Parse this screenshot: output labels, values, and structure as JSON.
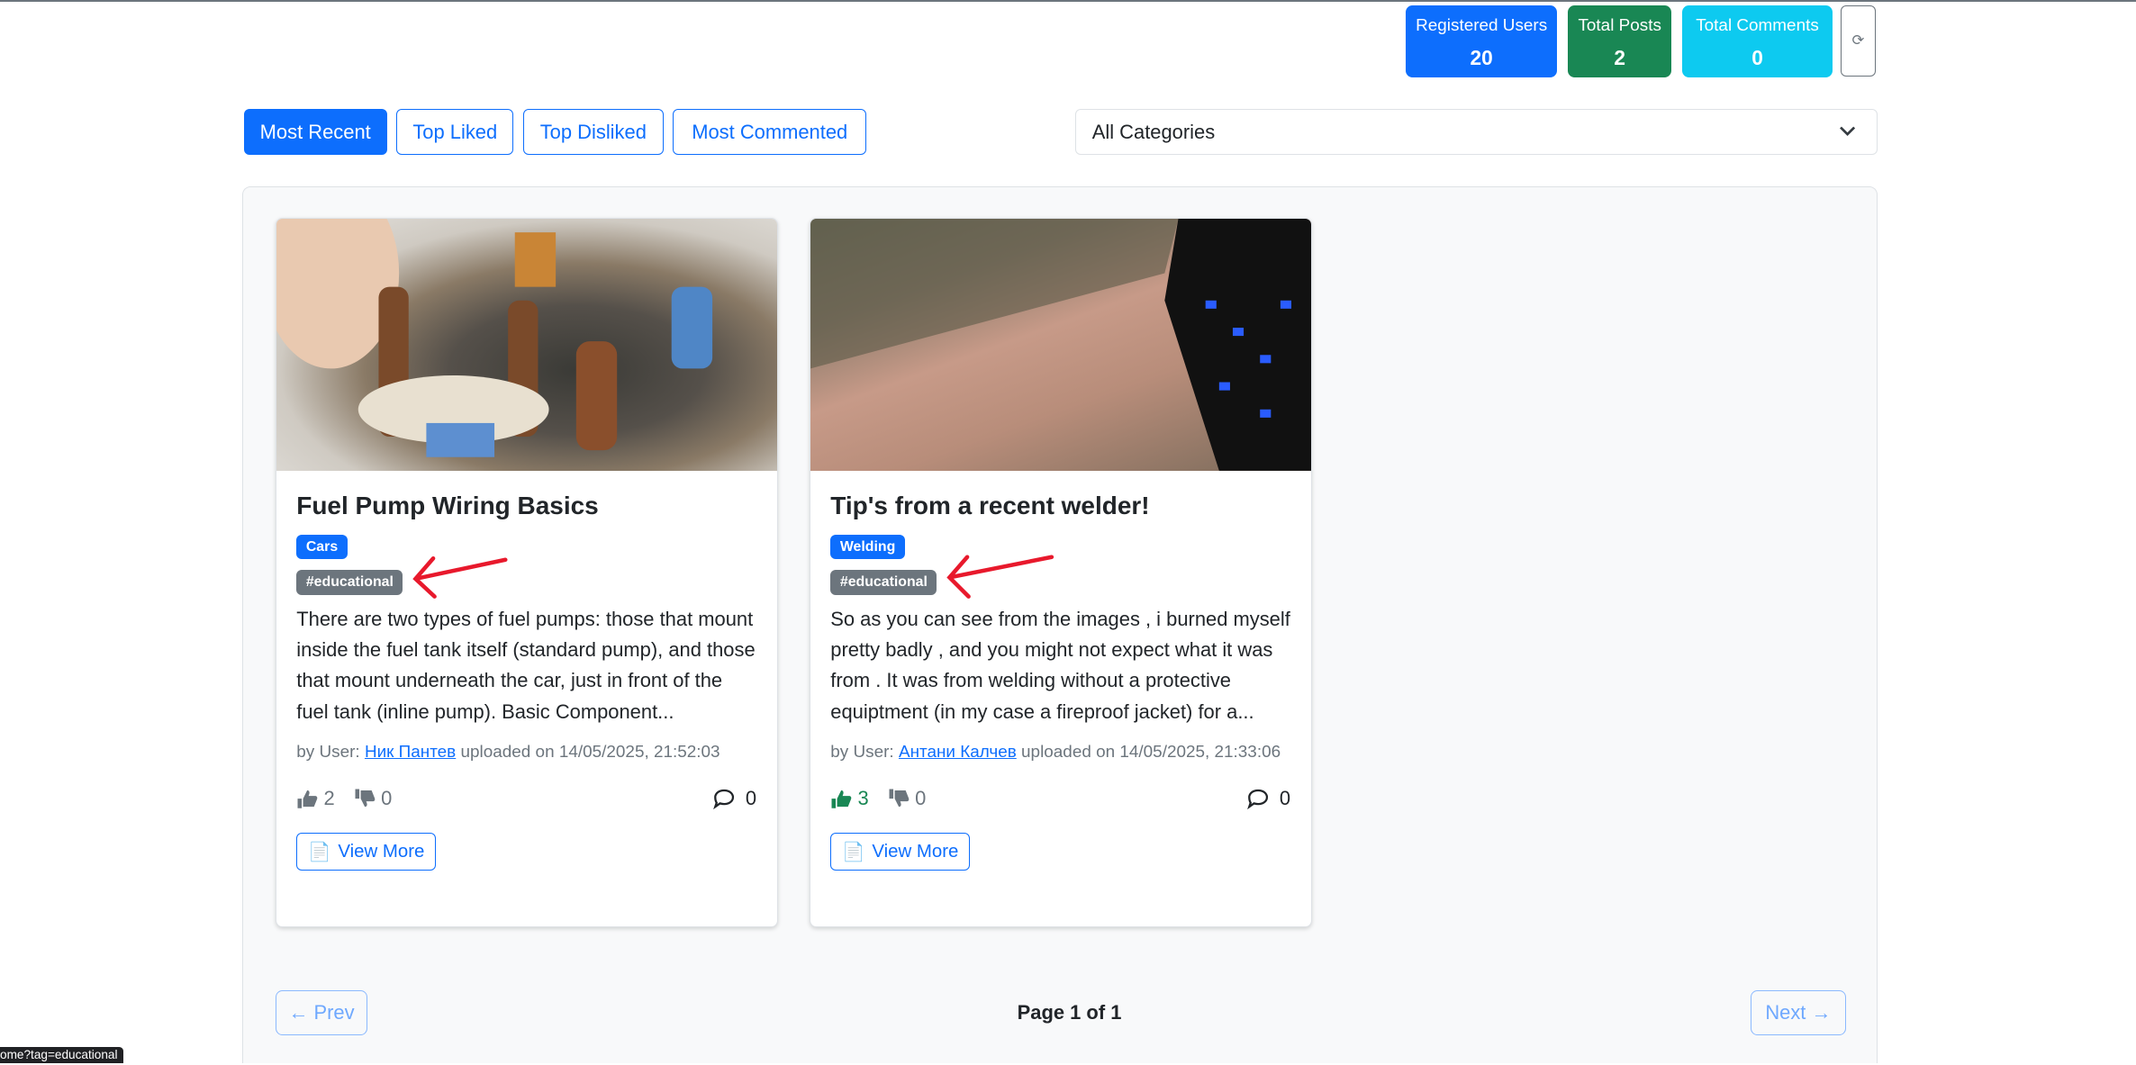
{
  "stats": {
    "registered_users": {
      "label": "Registered Users",
      "value": "20",
      "color": "#0d6efd"
    },
    "total_posts": {
      "label": "Total Posts",
      "value": "2",
      "color": "#198754"
    },
    "total_comments": {
      "label": "Total Comments",
      "value": "0",
      "color": "#0dcaf0"
    },
    "refresh_icon": "⟳"
  },
  "filters": {
    "buttons": [
      "Most Recent",
      "Top Liked",
      "Top Disliked",
      "Most Commented"
    ],
    "active": "Most Recent"
  },
  "category_select": {
    "value": "All Categories"
  },
  "posts": [
    {
      "title": "Fuel Pump Wiring Basics",
      "category": "Cars",
      "tag": "#educational",
      "excerpt": "There are two types of fuel pumps: those that mount inside the fuel tank itself (standard pump), and those that mount underneath the car, just in front of the fuel tank (inline pump). Basic Component...",
      "by_label": "by User:",
      "author": "Ник Пантев",
      "uploaded": "uploaded on 14/05/2025, 21:52:03",
      "likes": "2",
      "dislikes": "0",
      "comments": "0",
      "view_more": "View More"
    },
    {
      "title": "Tip's from a recent welder!",
      "category": "Welding",
      "tag": "#educational",
      "excerpt": "So as you can see from the images , i burned myself pretty badly , and you might not expect what it was from . It was from welding without a protective equiptment (in my case a fireproof jacket) for a...",
      "by_label": "by User:",
      "author": "Антани Калчев",
      "uploaded": "uploaded on 14/05/2025, 21:33:06",
      "likes": "3",
      "dislikes": "0",
      "comments": "0",
      "view_more": "View More"
    }
  ],
  "pagination": {
    "prev": "← Prev",
    "page_info": "Page 1 of 1",
    "next": "Next →"
  },
  "status_bar": {
    "url": "ome?tag=educational"
  },
  "annotation_color": "#e8192c"
}
